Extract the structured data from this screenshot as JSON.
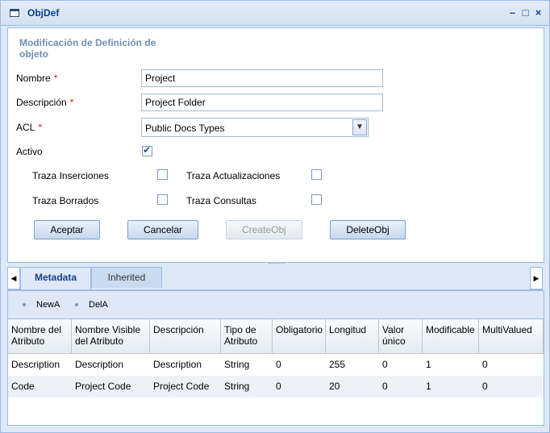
{
  "window": {
    "title": "ObjDef"
  },
  "form": {
    "section_title": "Modificación de Definición de objeto",
    "nombre_label": "Nombre",
    "nombre_value": "Project",
    "descripcion_label": "Descripción",
    "descripcion_value": "Project Folder",
    "acl_label": "ACL",
    "acl_value": "Public Docs Types",
    "required_mark": "*",
    "activo_label": "Activo",
    "activo_checked": true,
    "traza_inserciones_label": "Traza Inserciones",
    "traza_actualizaciones_label": "Traza Actualizaciones",
    "traza_borrados_label": "Traza Borrados",
    "traza_consultas_label": "Traza Consultas",
    "buttons": {
      "aceptar": "Aceptar",
      "cancelar": "Cancelar",
      "create": "CreateObj",
      "delete": "DeleteObj"
    }
  },
  "tabs": [
    {
      "label": "Metadata",
      "active": true
    },
    {
      "label": "Inherited",
      "active": false
    }
  ],
  "toolbar": {
    "new": "NewA",
    "del": "DelA"
  },
  "grid": {
    "columns": [
      "Nombre del Atributo",
      "Nombre Visible del Atributo",
      "Descripción",
      "Tipo de Atributo",
      "Obligatorio",
      "Longitud",
      "Valor único",
      "Modificable",
      "MultiValued"
    ],
    "rows": [
      [
        "Description",
        "Description",
        "Description",
        "String",
        "0",
        "255",
        "0",
        "1",
        "0"
      ],
      [
        "Code",
        "Project Code",
        "Project Code",
        "String",
        "0",
        "20",
        "0",
        "1",
        "0"
      ]
    ]
  }
}
